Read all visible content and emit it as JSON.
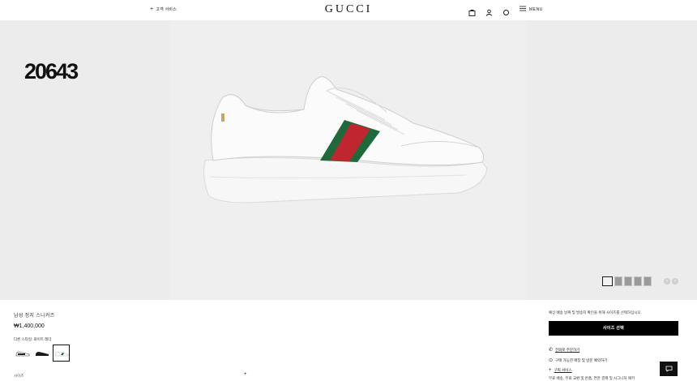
{
  "header": {
    "client_service": "고객 서비스",
    "logo": "GUCCI",
    "menu_label": "MENU",
    "icons": [
      "bag-icon",
      "account-icon",
      "search-icon",
      "hamburger-icon"
    ]
  },
  "hero": {
    "watermark": "20643",
    "gallery_count": 5,
    "active_index": 0
  },
  "product": {
    "name": "남성 정지 스니커즈",
    "price": "₩1,400,000",
    "variant_label": "다른 스타일: 화이트 레더",
    "variants": [
      "black-white-sneaker",
      "black-sneaker",
      "white-sneaker"
    ],
    "selected_variant": 2,
    "size_label": "사이즈",
    "size_toggle": "+"
  },
  "purchase": {
    "ship_note": "예상 배송 날짜 및 발송지 확인을 위해 사이즈를 선택하십시오.",
    "select_size_button": "사이즈 선택",
    "call_order": "전화로 주문하기",
    "store_note": "구매 가능한 매장 및 방문 예약하기",
    "gucci_service": "구찌 서비스",
    "service_desc": "무료 배송, 무료 교환 및 반품, 연한 결제 및 시그니처 패키"
  },
  "colors": {
    "accent": "#000000",
    "stripe_green": "#1f6a3a",
    "stripe_red": "#c0262f",
    "hero_bg": "#ececec"
  }
}
